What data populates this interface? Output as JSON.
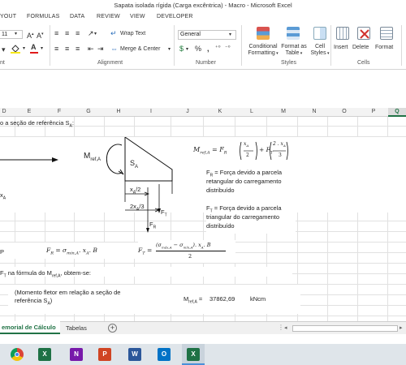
{
  "window": {
    "title": "Sapata isolada rígida (Carga excêntrica) - Macro - Microsoft Excel"
  },
  "tabs": [
    "YOUT",
    "FORMULAS",
    "DATA",
    "REVIEW",
    "VIEW",
    "DEVELOPER"
  ],
  "ribbon": {
    "font_size": "11",
    "wrap_text": "Wrap Text",
    "merge_center": "Merge & Center",
    "number_format": "General",
    "percent": "%",
    "comma": ",",
    "cond_format": [
      "Conditional",
      "Formatting"
    ],
    "format_table": [
      "Format as",
      "Table"
    ],
    "cell_styles": [
      "Cell",
      "Styles"
    ],
    "insert": "Insert",
    "delete": "Delete",
    "format": "Format",
    "groups": {
      "font": "nt",
      "alignment": "Alignment",
      "number": "Number",
      "styles": "Styles",
      "cells": "Cells"
    }
  },
  "columns": [
    "D",
    "E",
    "F",
    "G",
    "H",
    "I",
    "J",
    "K",
    "L",
    "M",
    "N",
    "O",
    "P",
    "Q"
  ],
  "cells": {
    "row1": "o a seção de referência S",
    "row1_sub": "A",
    "row1_tail": ":",
    "xa_label": "x",
    "xa_sub": "A",
    "p_label": "P",
    "ft_note": "F",
    "ft_note_sub": "T",
    "ft_note_tail": " na fórmula do M",
    "ft_note_sub2": "ref,A",
    "ft_note_end": ", obtem-se:",
    "momento_desc_1": "(Momento fletor em relação a seção de",
    "momento_desc_2": "referência S",
    "momento_desc_sub": "A",
    "momento_desc_end": ")",
    "mref_label": "M",
    "mref_label_sub": "ref,A",
    "mref_label_end": " =",
    "mref_value": "37862,69",
    "mref_unit": "kNcm"
  },
  "diagram": {
    "moment_label": "M",
    "moment_sub": "ref,A",
    "section_label": "S",
    "section_sub": "A",
    "dim1": "x",
    "dim1_sub": "A",
    "dim1_tail": "/2",
    "dim2": "2x",
    "dim2_sub": "A",
    "dim2_tail": "/3",
    "ft": "F",
    "ft_sub": "T",
    "fr": "F",
    "fr_sub": "R"
  },
  "formulas": {
    "main": "M",
    "main_sub": "ref,A",
    "fr_eq": "F",
    "fr_sub": "R",
    "fr_rhs": "= σ",
    "fr_rhs_sub": "mín,A",
    "fr_rhs_tail": ". x",
    "fr_rhs_sub2": "A",
    "fr_rhs_end": ". B",
    "ft_eq": "F",
    "ft_sub": "T",
    "ft_num": "(σ",
    "ft_num_sub1": "máx,A",
    "ft_num_mid": " − σ",
    "ft_num_sub2": "mín,A",
    "ft_num_tail": "). x",
    "ft_num_sub3": "A",
    "ft_num_end": ". B",
    "ft_den": "2"
  },
  "notes": {
    "fr_lines": [
      "F",
      "R",
      " = Força devido a parcela",
      "retangular do carregamento",
      "distribuído"
    ],
    "ft_lines": [
      "F",
      "T",
      " = Força devido a parcela",
      "triangular do carregamento",
      "distribuído"
    ]
  },
  "sheets": {
    "active": "emorial de Cálculo",
    "other": "Tabelas",
    "add": "+"
  },
  "taskbar_apps": [
    "chrome-icon",
    "excel-icon",
    "onenote-icon",
    "powerpoint-icon",
    "word-icon",
    "outlook-icon",
    "excel-active-icon"
  ]
}
